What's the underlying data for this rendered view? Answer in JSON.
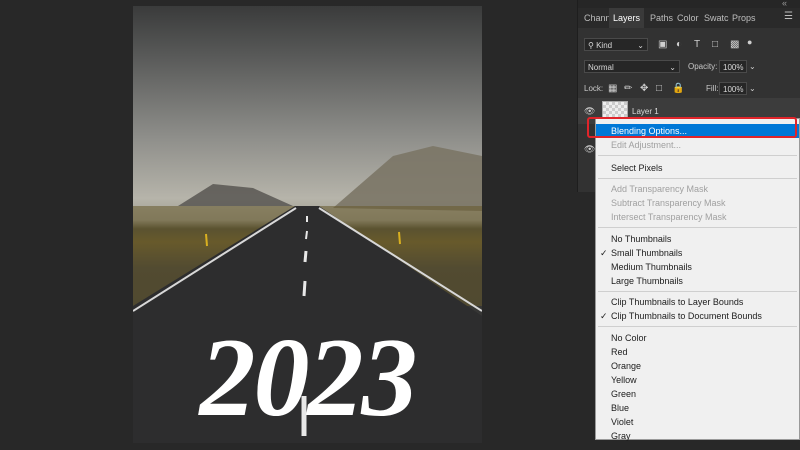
{
  "document": {
    "year_text": "2023"
  },
  "panel": {
    "tabs": [
      "Chann",
      "Layers",
      "Paths",
      "Color",
      "Swatc",
      "Props"
    ],
    "active_tab": "Layers",
    "filter_kind": "Kind",
    "blend_mode": "Normal",
    "opacity_label": "Opacity:",
    "opacity_value": "100%",
    "lock_label": "Lock:",
    "fill_label": "Fill:",
    "fill_value": "100%",
    "layer_name": "Layer 1"
  },
  "context_menu": {
    "items": [
      {
        "label": "Blending Options...",
        "state": "highlighted"
      },
      {
        "label": "Edit Adjustment...",
        "state": "disabled"
      },
      {
        "label": "Select Pixels",
        "state": "enabled"
      },
      {
        "label": "Add Transparency Mask",
        "state": "disabled"
      },
      {
        "label": "Subtract Transparency Mask",
        "state": "disabled"
      },
      {
        "label": "Intersect Transparency Mask",
        "state": "disabled"
      },
      {
        "label": "No Thumbnails",
        "state": "enabled"
      },
      {
        "label": "Small Thumbnails",
        "state": "checked"
      },
      {
        "label": "Medium Thumbnails",
        "state": "enabled"
      },
      {
        "label": "Large Thumbnails",
        "state": "enabled"
      },
      {
        "label": "Clip Thumbnails to Layer Bounds",
        "state": "enabled"
      },
      {
        "label": "Clip Thumbnails to Document Bounds",
        "state": "checked"
      },
      {
        "label": "No Color",
        "state": "enabled"
      },
      {
        "label": "Red",
        "state": "enabled"
      },
      {
        "label": "Orange",
        "state": "enabled"
      },
      {
        "label": "Yellow",
        "state": "enabled"
      },
      {
        "label": "Green",
        "state": "enabled"
      },
      {
        "label": "Blue",
        "state": "enabled"
      },
      {
        "label": "Violet",
        "state": "enabled"
      },
      {
        "label": "Gray",
        "state": "enabled"
      }
    ]
  },
  "colors": {
    "highlight": "#0078d7",
    "annotation": "#e0242a"
  }
}
